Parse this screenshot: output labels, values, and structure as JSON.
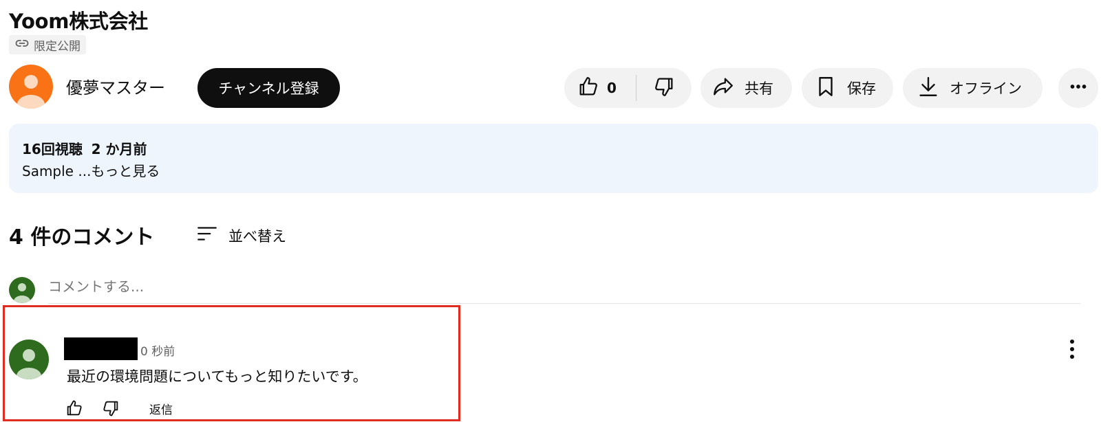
{
  "video": {
    "title": "Yoom株式会社",
    "visibility": "限定公開"
  },
  "channel": {
    "name": "優夢マスター",
    "subscribe_label": "チャンネル登録"
  },
  "actions": {
    "like_count": "0",
    "share_label": "共有",
    "save_label": "保存",
    "offline_label": "オフライン"
  },
  "description": {
    "views": "16回視聴",
    "age": "2 か月前",
    "text": "Sample ...もっと見る"
  },
  "comments": {
    "count_label": "4 件のコメント",
    "sort_label": "並べ替え",
    "input_placeholder": "コメントする...",
    "items": [
      {
        "time": "0 秒前",
        "text": "最近の環境問題についてもっと知りたいです。",
        "reply_label": "返信"
      }
    ]
  },
  "colors": {
    "channel_avatar": "#f97316",
    "user_avatar": "#2e6b1f",
    "description_bg": "#eef5fd",
    "highlight_border": "#e02b20"
  },
  "icons": [
    "link-icon",
    "like-icon",
    "dislike-icon",
    "share-icon",
    "bookmark-icon",
    "download-icon",
    "more-horizontal-icon",
    "sort-icon",
    "more-vertical-icon"
  ]
}
